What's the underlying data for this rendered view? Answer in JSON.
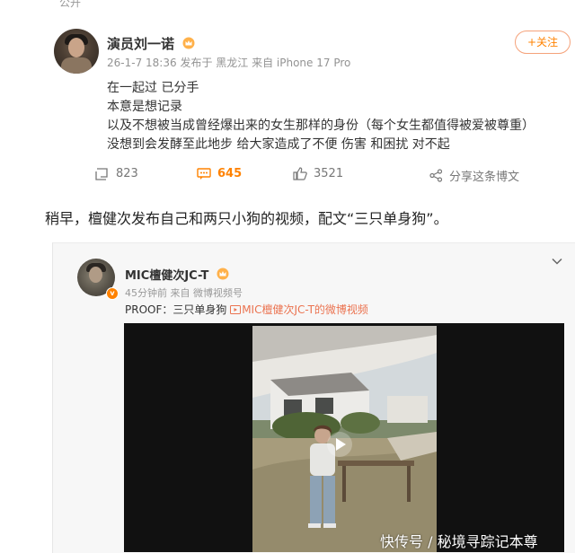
{
  "top_label": "公开",
  "post": {
    "author": "演员刘一诺",
    "timestamp": "26-1-7 18:36",
    "location": "发布于 黑龙江",
    "device": "来自 iPhone 17 Pro",
    "follow_label": "+关注",
    "lines": [
      "在一起过 已分手",
      "本意是想记录",
      "以及不想被当成曾经爆出来的女生那样的身份（每个女生都值得被爱被尊重）",
      "没想到会发酵至此地步 给大家造成了不便 伤害 和困扰 对不起"
    ],
    "reposts": "823",
    "comments": "645",
    "likes": "3521",
    "share_label": "分享这条博文"
  },
  "caption": "稍早，檀健次发布自己和两只小狗的视频，配文“三只单身狗”。",
  "embedded": {
    "author": "MIC檀健次JC-T",
    "time": "45分钟前",
    "source": "来自 微博视频号",
    "verified_mark": "v",
    "text": "PROOF：三只单身狗 ",
    "video_link": "MIC檀健次JC-T的微博视频"
  },
  "watermark": "快传号 / 秘境寻踪记本尊",
  "colors": {
    "accent": "#ff8200",
    "link": "#eb7350"
  }
}
